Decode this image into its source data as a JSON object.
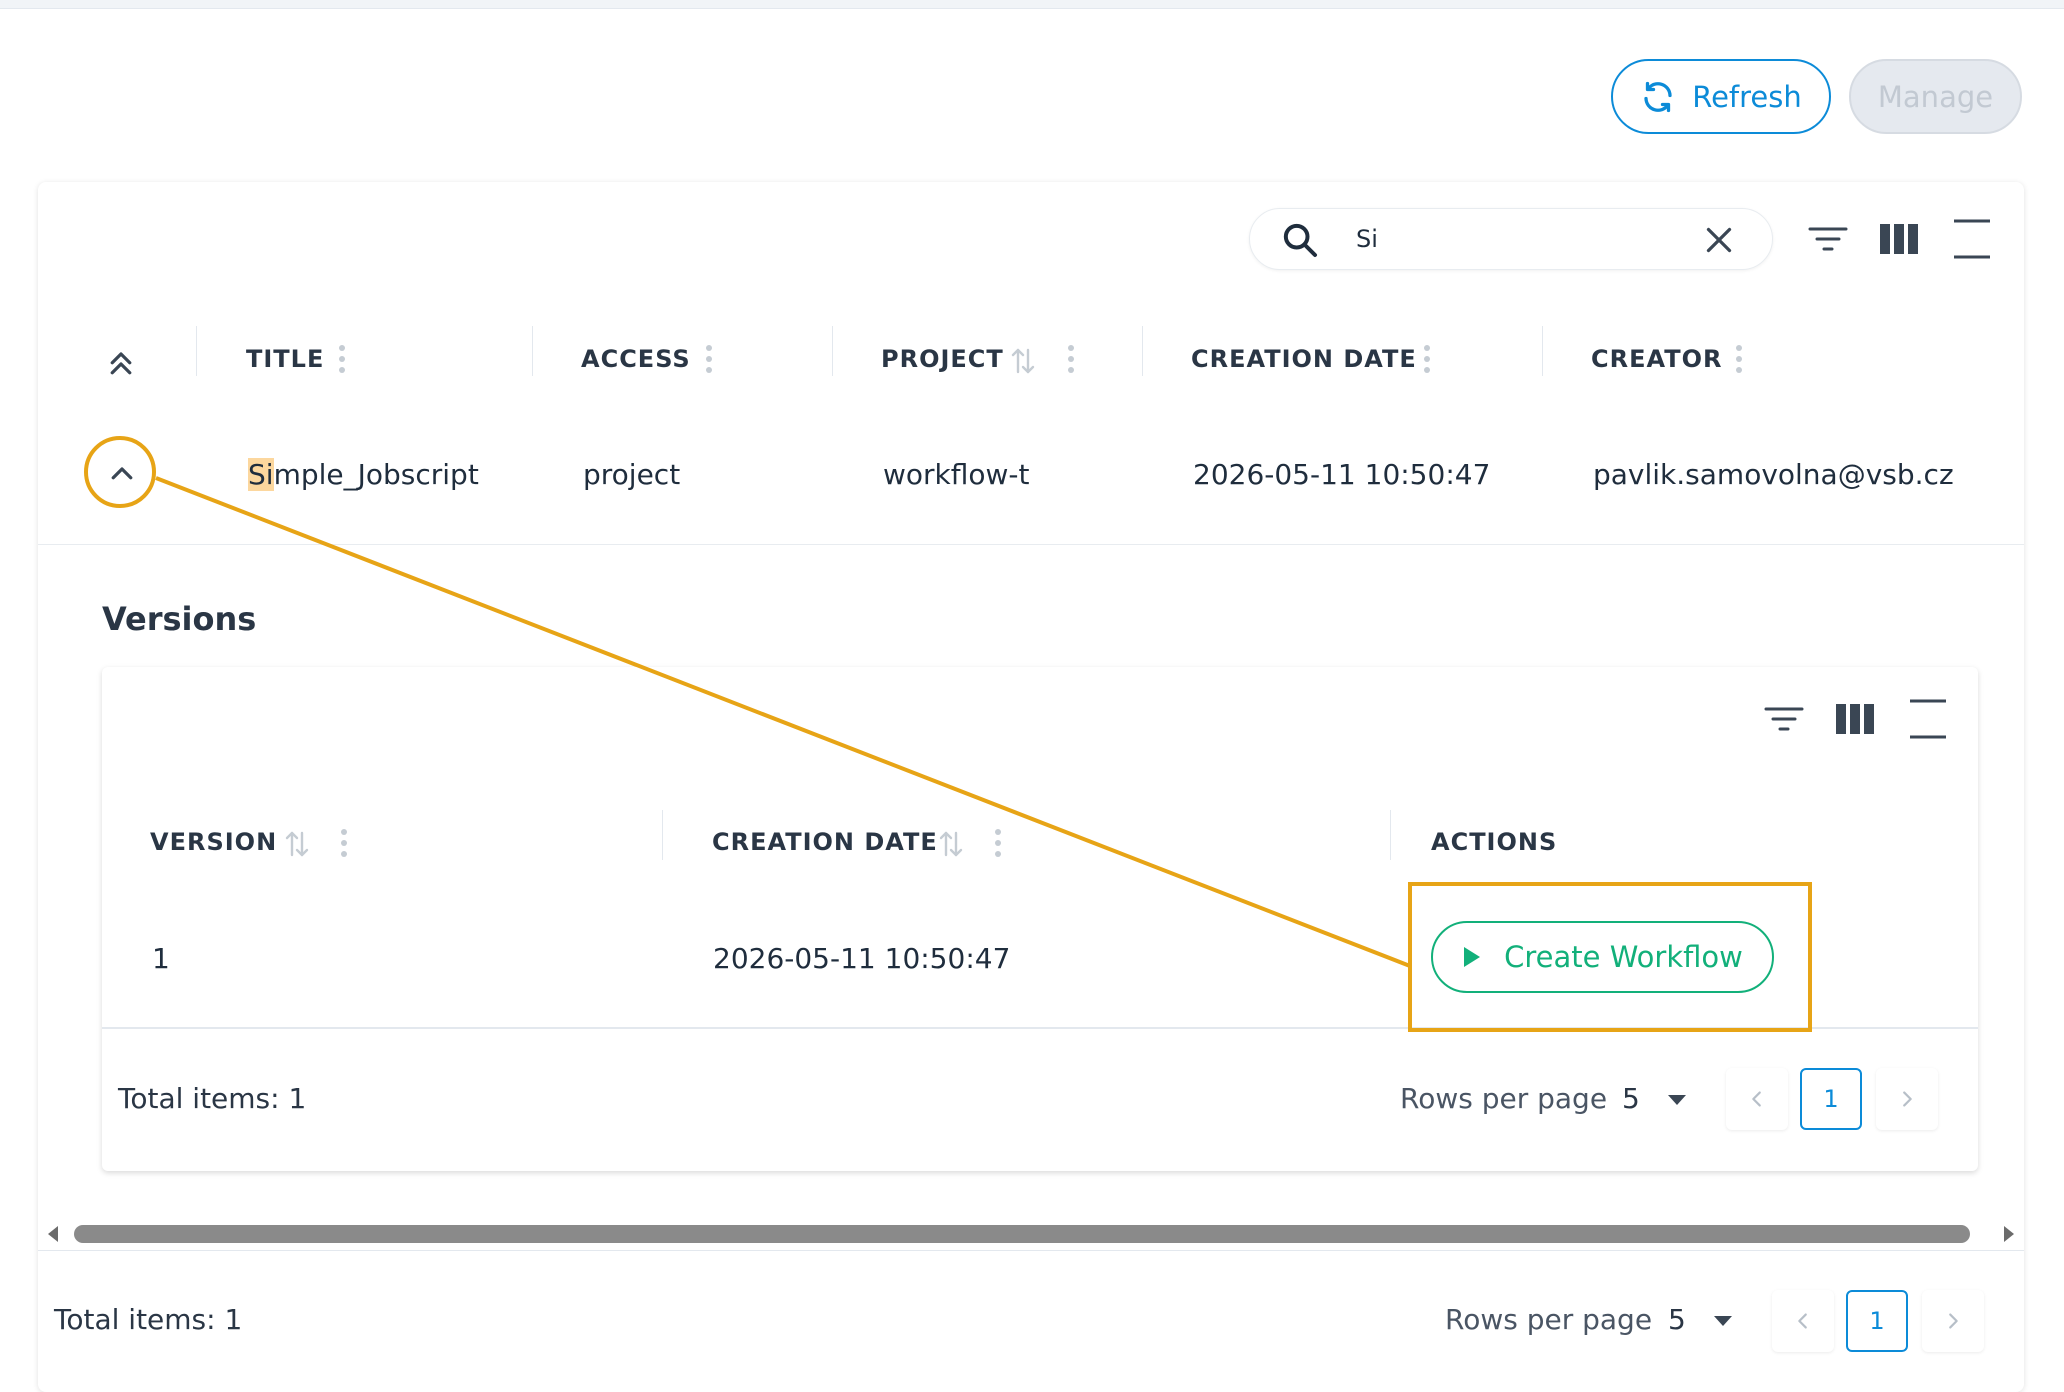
{
  "toolbar": {
    "refresh_label": "Refresh",
    "refresh_icon": "refresh-icon",
    "manage_label": "Manage"
  },
  "search": {
    "value": "Si",
    "icon": "search-icon",
    "clear_icon": "close-icon"
  },
  "table": {
    "columns": [
      {
        "label": "TITLE",
        "sortable": false
      },
      {
        "label": "ACCESS",
        "sortable": false
      },
      {
        "label": "PROJECT",
        "sortable": true
      },
      {
        "label": "CREATION DATE",
        "sortable": false
      },
      {
        "label": "CREATOR",
        "sortable": false
      }
    ],
    "rows": [
      {
        "title_highlight": "Si",
        "title_rest": "mple_Jobscript",
        "access": "project",
        "project": "workflow-t",
        "creation_date": "2026-05-11 10:50:47",
        "creator": "pavlik.samovolna@vsb.cz",
        "expanded": true
      }
    ],
    "total_items": "Total items: 1",
    "rows_per_page_label": "Rows per page",
    "rows_per_page": "5",
    "current_page": "1"
  },
  "versions": {
    "title": "Versions",
    "columns": [
      {
        "label": "VERSION",
        "sortable": true
      },
      {
        "label": "CREATION DATE",
        "sortable": true
      },
      {
        "label": "ACTIONS",
        "sortable": false
      }
    ],
    "rows": [
      {
        "version": "1",
        "creation_date": "2026-05-11 10:50:47",
        "action_label": "Create Workflow",
        "action_icon": "play-icon"
      }
    ],
    "total_items": "Total items: 1",
    "rows_per_page_label": "Rows per page",
    "rows_per_page": "5",
    "current_page": "1"
  },
  "colors": {
    "primary": "#0c8bd8",
    "success": "#12b07a",
    "annotation": "#e7a416",
    "highlight": "#fcd79e",
    "disabled_bg": "#e5e9ef"
  }
}
